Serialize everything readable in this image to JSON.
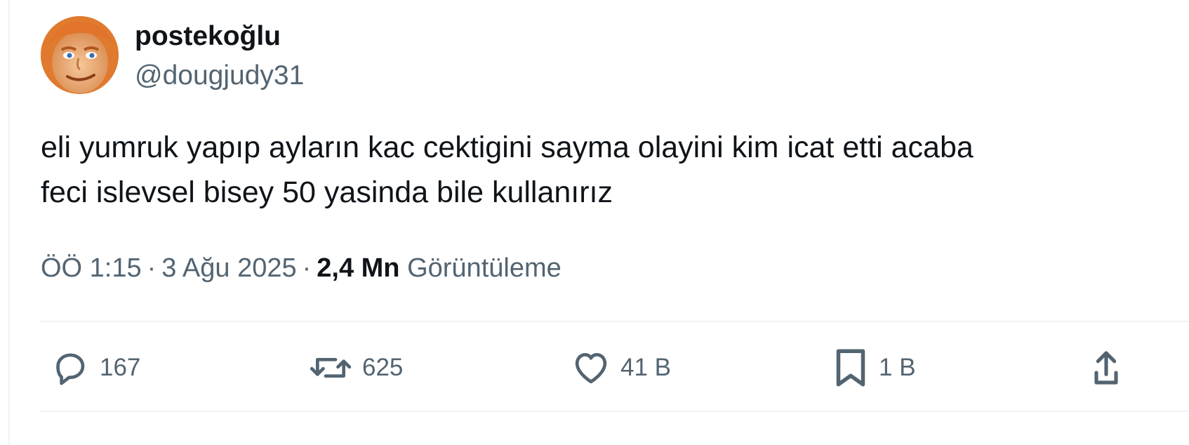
{
  "author": {
    "display_name": "postekoğlu",
    "handle": "@dougjudy31"
  },
  "tweet": {
    "lines": [
      "eli yumruk yapıp ayların kac cektigini sayma olayini kim icat etti acaba",
      "feci islevsel bisey 50 yasinda bile kullanırız"
    ]
  },
  "meta": {
    "time": "ÖÖ 1:15",
    "separator": "·",
    "date": "3 Ağu 2025",
    "views_count": "2,4 Mn",
    "views_label": "Görüntüleme"
  },
  "actions": {
    "replies": "167",
    "retweets": "625",
    "likes": "41 B",
    "bookmarks": "1 B"
  },
  "icons": {
    "reply": "reply-icon",
    "retweet": "retweet-icon",
    "like": "heart-icon",
    "bookmark": "bookmark-icon",
    "share": "share-icon"
  },
  "colors": {
    "text_primary": "#0f1419",
    "text_secondary": "#536471",
    "divider": "#eff3f4"
  }
}
